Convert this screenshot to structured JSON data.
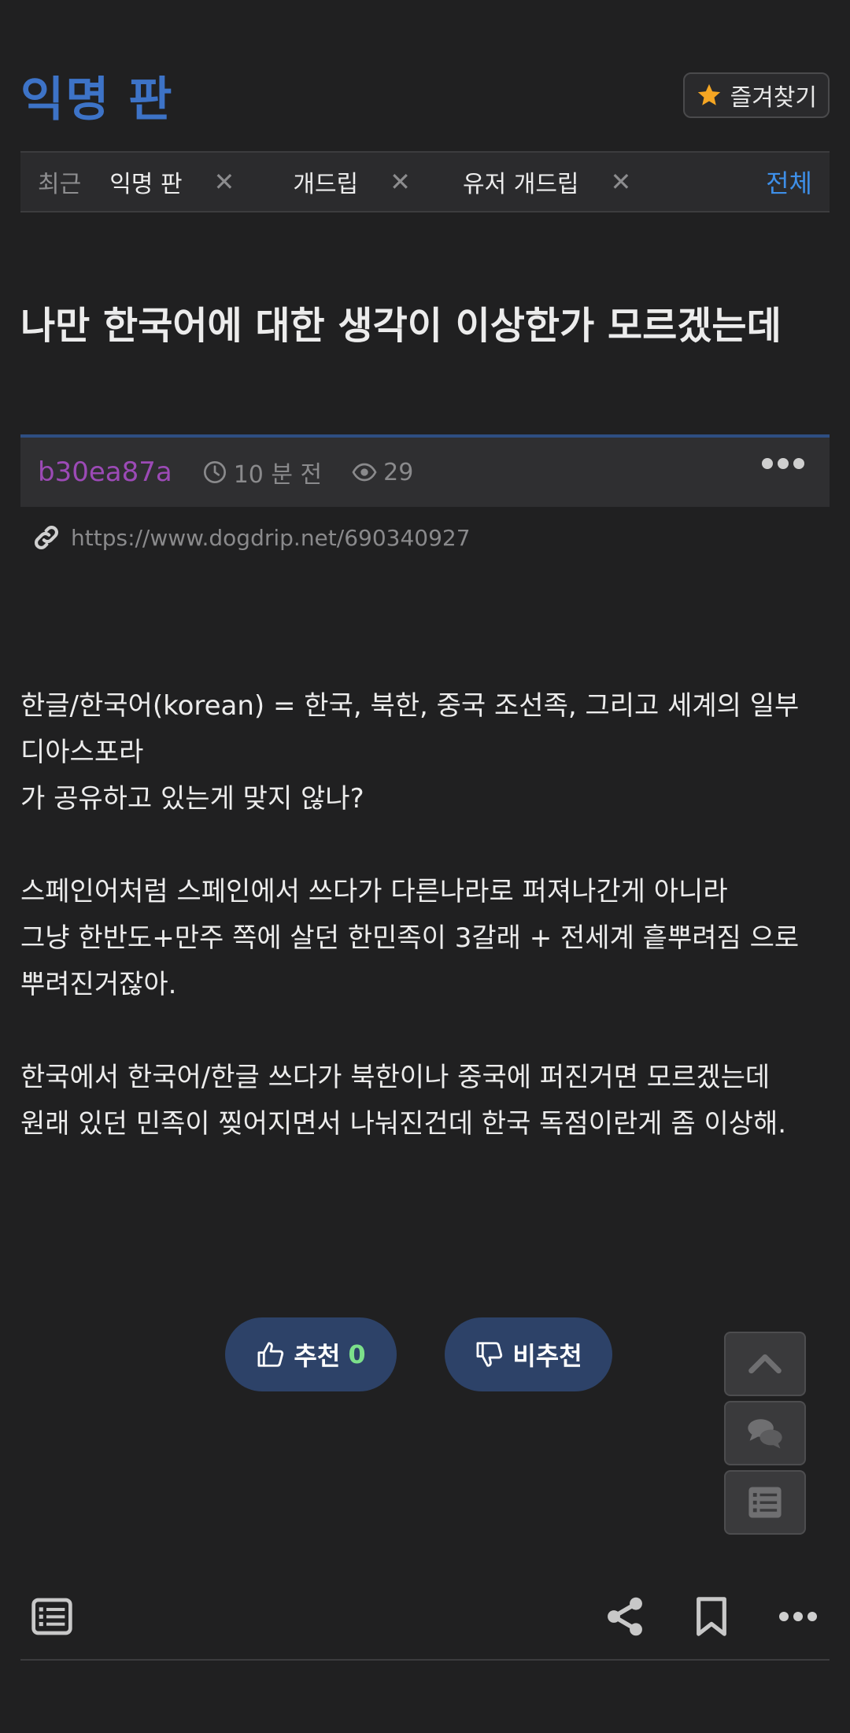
{
  "header": {
    "board_title": "익명 판",
    "favorites_label": "즐겨찾기"
  },
  "recent": {
    "label": "최근",
    "items": [
      {
        "label": "익명 판"
      },
      {
        "label": "개드립"
      },
      {
        "label": "유저 개드립"
      }
    ],
    "all_label": "전체"
  },
  "post": {
    "title": "나만 한국어에 대한 생각이 이상한가 모르겠는데",
    "author": "b30ea87a",
    "time_ago": "10 분 전",
    "views": "29",
    "url": "https://www.dogdrip.net/690340927",
    "body_lines": [
      "한글/한국어(korean) = 한국, 북한, 중국 조선족, 그리고 세계의 일부 디아스포라",
      "가 공유하고 있는게 맞지 않나?",
      "",
      "스페인어처럼 스페인에서 쓰다가 다른나라로 퍼져나간게 아니라",
      "그냥 한반도+만주 쪽에 살던 한민족이 3갈래 + 전세계 흩뿌려짐 으로 뿌려진거잖아.",
      "",
      "한국에서 한국어/한글 쓰다가 북한이나 중국에 퍼진거면 모르겠는데",
      "원래 있던 민족이 찢어지면서 나눠진건데 한국 독점이란게 좀 이상해."
    ]
  },
  "vote": {
    "up_label": "추천",
    "up_count": "0",
    "down_label": "비추천"
  },
  "colors": {
    "background": "#202021",
    "title_blue": "#3d73c7",
    "author_purple": "#9c4ab6",
    "accent_blue": "#3e8fe8",
    "vote_bg": "#2d4268",
    "vote_count_green": "#7ce08a",
    "star_orange": "#f5a623"
  }
}
